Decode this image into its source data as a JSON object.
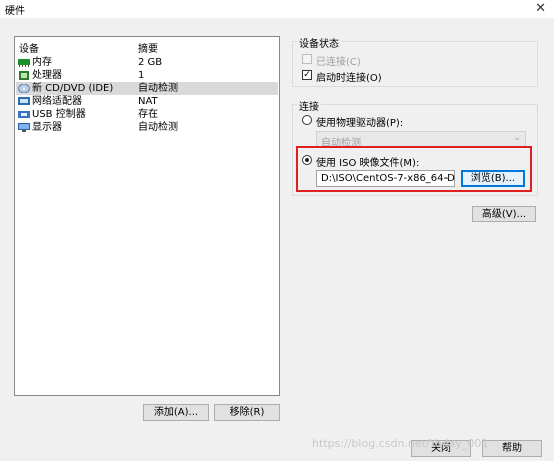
{
  "window": {
    "title": "硬件"
  },
  "device_list": {
    "header": {
      "device": "设备",
      "summary": "摘要"
    },
    "rows": [
      {
        "name": "内存",
        "summary": "2 GB",
        "icon": "memory-icon",
        "selected": false
      },
      {
        "name": "处理器",
        "summary": "1",
        "icon": "cpu-icon",
        "selected": false
      },
      {
        "name": "新 CD/DVD (IDE)",
        "summary": "自动检测",
        "icon": "cd-dvd-icon",
        "selected": true
      },
      {
        "name": "网络适配器",
        "summary": "NAT",
        "icon": "network-adapter-icon",
        "selected": false
      },
      {
        "name": "USB 控制器",
        "summary": "存在",
        "icon": "usb-icon",
        "selected": false
      },
      {
        "name": "显示器",
        "summary": "自动检测",
        "icon": "monitor-icon",
        "selected": false
      }
    ]
  },
  "buttons": {
    "add": "添加(A)...",
    "remove": "移除(R)",
    "close": "关闭",
    "help": "帮助"
  },
  "device_status": {
    "title": "设备状态",
    "connected": {
      "label": "已连接(C)",
      "checked": false,
      "disabled": true
    },
    "connect_on_power": {
      "label": "启动时连接(O)",
      "checked": true
    }
  },
  "connection": {
    "title": "连接",
    "physical": {
      "label": "使用物理驱动器(P):",
      "selected": false,
      "dropdown_value": "自动检测"
    },
    "iso": {
      "label": "使用 ISO 映像文件(M):",
      "selected": true,
      "path": "D:\\ISO\\CentOS-7-x86_64-D",
      "browse": "浏览(B)..."
    }
  },
  "advanced": "高级(V)...",
  "watermark": "https://blog.csdn.net/Yoday_001",
  "colors": {
    "highlight": "#e02020",
    "selection": "#d9d9d9",
    "button_focus": "#0078d7"
  }
}
